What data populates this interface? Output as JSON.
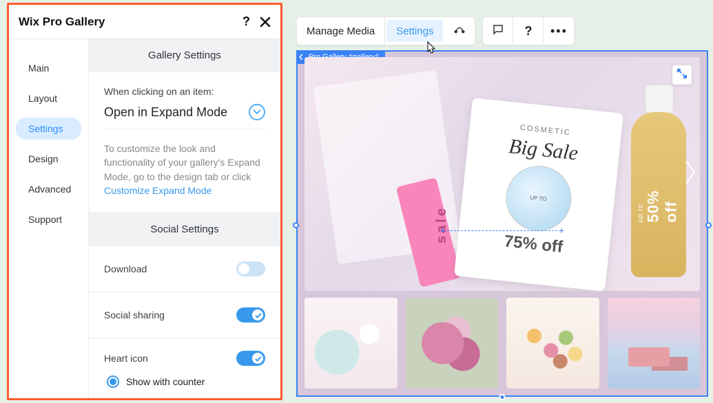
{
  "panel": {
    "title": "Wix Pro Gallery",
    "help_label": "?",
    "sidebar": {
      "items": [
        {
          "label": "Main"
        },
        {
          "label": "Layout"
        },
        {
          "label": "Settings"
        },
        {
          "label": "Design"
        },
        {
          "label": "Advanced"
        },
        {
          "label": "Support"
        }
      ],
      "active_index": 2
    },
    "gallery_settings": {
      "header": "Gallery Settings",
      "click_label": "When clicking on an item:",
      "click_value": "Open in Expand Mode",
      "info_text": "To customize the look and functionality of your gallery's Expand Mode, go to the design tab or click ",
      "info_link": "Customize Expand Mode"
    },
    "social_settings": {
      "header": "Social Settings",
      "download_label": "Download",
      "download_on": false,
      "sharing_label": "Social sharing",
      "sharing_on": true,
      "heart_label": "Heart icon",
      "heart_on": true,
      "heart_option": "Show with counter"
    }
  },
  "toolbar": {
    "manage_media": "Manage Media",
    "settings": "Settings"
  },
  "canvas": {
    "badge": "Pro Gallery #gallery1",
    "main_slide": {
      "cosmetic_label": "COSMETIC",
      "big_sale": "Big Sale",
      "pink_label": "sale",
      "disc_up": "UP TO",
      "off_text": "75% off",
      "bottle_up": "up to",
      "bottle_text": "50% off"
    }
  }
}
